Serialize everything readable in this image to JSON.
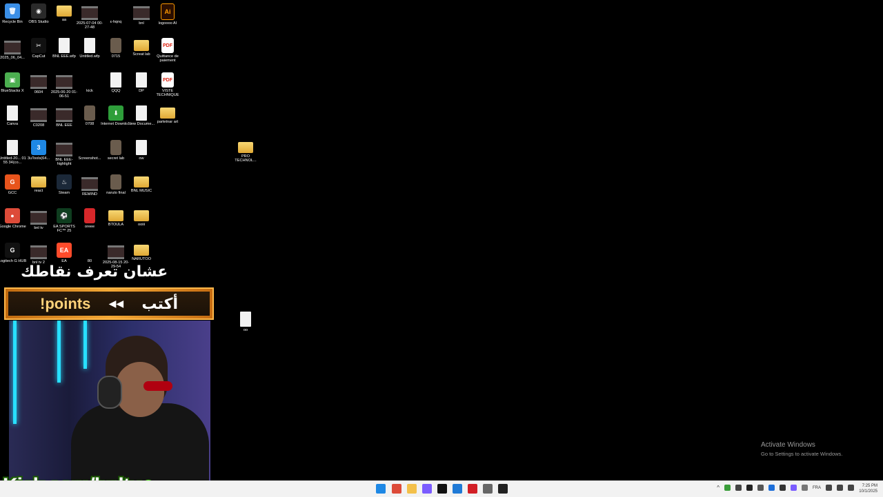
{
  "desktop_icons": [
    {
      "label": "Recycle Bin",
      "type": "exe",
      "glyph": "🗑",
      "color": "#3a8ee6"
    },
    {
      "label": "OBS Studio",
      "type": "exe",
      "glyph": "◉",
      "color": "#2a2a2a"
    },
    {
      "label": "aa",
      "type": "folder"
    },
    {
      "label": "2025-07-04 00-27-48",
      "type": "video"
    },
    {
      "label": "ε-hqnq",
      "type": "blank"
    },
    {
      "label": "bnl",
      "type": "video"
    },
    {
      "label": "logoooo AI",
      "type": "ai",
      "glyph": "Ai"
    },
    {
      "label": "2025_06_04...",
      "type": "video"
    },
    {
      "label": "CapCut",
      "type": "exe",
      "glyph": "✂",
      "color": "#111"
    },
    {
      "label": "BNL EEE.wfp",
      "type": "file"
    },
    {
      "label": "Untitled.wfp",
      "type": "file"
    },
    {
      "label": "0715",
      "type": "img"
    },
    {
      "label": "Screat lab",
      "type": "folder"
    },
    {
      "label": "Quittance de paiement",
      "type": "pdf",
      "glyph": "PDF"
    },
    {
      "label": "BlueStacks X",
      "type": "exe",
      "glyph": "▣",
      "color": "#4caf50"
    },
    {
      "label": "0604",
      "type": "video"
    },
    {
      "label": "2025-06-20 01-06-51",
      "type": "video"
    },
    {
      "label": "kick",
      "type": "blank"
    },
    {
      "label": "QQQ",
      "type": "file"
    },
    {
      "label": "DP",
      "type": "file"
    },
    {
      "label": "VISTE TECHNIQUE",
      "type": "pdf",
      "glyph": "PDF"
    },
    {
      "label": "Canva",
      "type": "file"
    },
    {
      "label": "C0208",
      "type": "video"
    },
    {
      "label": "BNL EEE",
      "type": "video"
    },
    {
      "label": "0708",
      "type": "img"
    },
    {
      "label": "Internet Downlo...",
      "type": "exe",
      "glyph": "⬇",
      "color": "#2e9e3a"
    },
    {
      "label": "New Docume...",
      "type": "file"
    },
    {
      "label": "partetnar art",
      "type": "folder"
    },
    {
      "label": "Untitled-20... 01 55 34(co...",
      "type": "file"
    },
    {
      "label": "3uTools(64...",
      "type": "exe",
      "glyph": "3",
      "color": "#1e88e5"
    },
    {
      "label": "BNL EEE-highlight",
      "type": "video"
    },
    {
      "label": "Screenshot...",
      "type": "blank"
    },
    {
      "label": "secret lab",
      "type": "img"
    },
    {
      "label": "ow",
      "type": "file"
    },
    {
      "label": "GCC",
      "type": "exe",
      "glyph": "G",
      "color": "#e8541c"
    },
    {
      "label": "react",
      "type": "folder"
    },
    {
      "label": "Steam",
      "type": "exe",
      "glyph": "♨",
      "color": "#1b2838"
    },
    {
      "label": "REMIND",
      "type": "video"
    },
    {
      "label": "naruto final",
      "type": "img"
    },
    {
      "label": "BNL MUSIC",
      "type": "folder"
    },
    {
      "label": "Google Chrome",
      "type": "exe",
      "glyph": "●",
      "color": "#dd4b39"
    },
    {
      "label": "bnl tv",
      "type": "video"
    },
    {
      "label": "EA SPORTS FC™ 25",
      "type": "exe",
      "glyph": "⚽",
      "color": "#0f3d1f"
    },
    {
      "label": "oreee",
      "type": "red"
    },
    {
      "label": "BTOULA",
      "type": "folder"
    },
    {
      "label": "ooiii",
      "type": "folder"
    },
    {
      "label": "Logitech G HUB",
      "type": "exe",
      "glyph": "G",
      "color": "#111"
    },
    {
      "label": "bnl tv 2",
      "type": "video"
    },
    {
      "label": "EA",
      "type": "exe",
      "glyph": "EA",
      "color": "#ff4b2b"
    },
    {
      "label": "80",
      "type": "blank"
    },
    {
      "label": "2025-08-15 20-29-54",
      "type": "video"
    },
    {
      "label": "NARUTOO",
      "type": "folder"
    },
    {
      "label": "PRO TECHNOL...",
      "type": "folder"
    },
    {
      "label": "oo",
      "type": "file"
    }
  ],
  "overlay": {
    "arabic_top": "عشان تعرف نقاطك",
    "banner_points": "!points",
    "banner_arrows": "◀◀",
    "banner_write": "أكتب",
    "kick_url": "Kick.com/bnltv",
    "kick_check": "✔"
  },
  "activation": {
    "title": "Activate Windows",
    "subtitle": "Go to Settings to activate Windows."
  },
  "taskbar": {
    "apps": [
      {
        "name": "start",
        "color": "#1e88e5"
      },
      {
        "name": "chrome",
        "color": "#dd4b39"
      },
      {
        "name": "file-explorer",
        "color": "#f3c04a"
      },
      {
        "name": "messenger",
        "color": "#7b5cff"
      },
      {
        "name": "capcut",
        "color": "#111111"
      },
      {
        "name": "photos",
        "color": "#1f7ad6"
      },
      {
        "name": "acrobat",
        "color": "#d21f26"
      },
      {
        "name": "settings",
        "color": "#666666"
      },
      {
        "name": "capcut-2",
        "color": "#222222"
      }
    ],
    "lang": "FRA",
    "time": "7:25 PM",
    "date": "10/1/2025"
  }
}
